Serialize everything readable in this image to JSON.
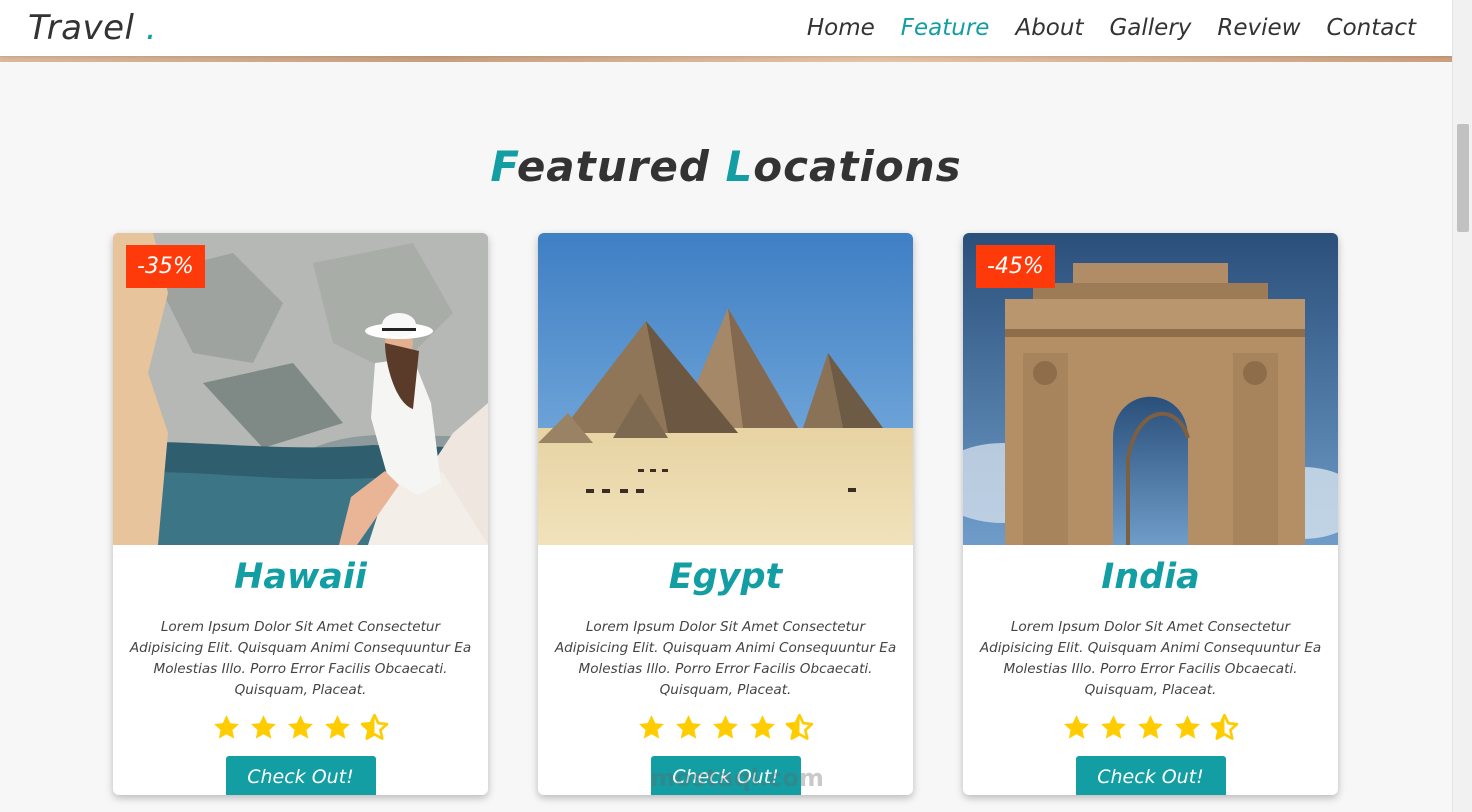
{
  "brand": {
    "name": "Travel",
    "dot": ".",
    "accent_color": "#129ea3"
  },
  "nav": {
    "items": [
      "Home",
      "Feature",
      "About",
      "Gallery",
      "Review",
      "Contact"
    ],
    "active": "Feature"
  },
  "section": {
    "title_first_letter": "F",
    "title_first_rest": "eatured",
    "title_second_letter": "L",
    "title_second_rest": "ocations"
  },
  "cards": [
    {
      "title": "Hawaii",
      "discount": "-35%",
      "image": "woman-on-rocks-by-sea",
      "description": "Lorem Ipsum Dolor Sit Amet Consectetur Adipisicing Elit. Quisquam Animi Consequuntur Ea Molestias Illo. Porro Error Facilis Obcaecati. Quisquam, Placeat.",
      "rating": 4.5,
      "button": "Check Out!"
    },
    {
      "title": "Egypt",
      "discount": "",
      "image": "pyramids-of-giza",
      "description": "Lorem Ipsum Dolor Sit Amet Consectetur Adipisicing Elit. Quisquam Animi Consequuntur Ea Molestias Illo. Porro Error Facilis Obcaecati. Quisquam, Placeat.",
      "rating": 4.5,
      "button": "Check Out!"
    },
    {
      "title": "India",
      "discount": "-45%",
      "image": "india-gate",
      "description": "Lorem Ipsum Dolor Sit Amet Consectetur Adipisicing Elit. Quisquam Animi Consequuntur Ea Molestias Illo. Porro Error Facilis Obcaecati. Quisquam, Placeat.",
      "rating": 4.5,
      "button": "Check Out!"
    }
  ],
  "icons": {
    "star": "star-icon",
    "half_star": "star-half-icon"
  },
  "colors": {
    "accent": "#129ea3",
    "discount_badge": "#ff3a0a",
    "star": "#ffcc00"
  },
  "watermark": {
    "text": "mostaql.com"
  }
}
